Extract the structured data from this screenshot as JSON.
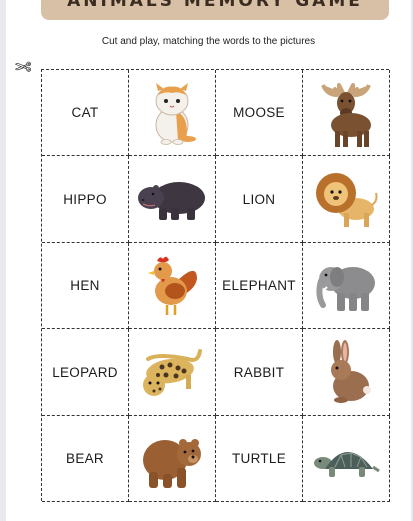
{
  "title": "ANIMALS MEMORY GAME",
  "subtitle": "Cut and play, matching the words to the pictures",
  "cut_icon": "scissors-icon",
  "cards": [
    {
      "word": "CAT",
      "picture": "cat-illustration"
    },
    {
      "word": "MOOSE",
      "picture": "moose-illustration"
    },
    {
      "word": "HIPPO",
      "picture": "hippo-illustration"
    },
    {
      "word": "LION",
      "picture": "lion-illustration"
    },
    {
      "word": "HEN",
      "picture": "hen-illustration"
    },
    {
      "word": "ELEPHANT",
      "picture": "elephant-illustration"
    },
    {
      "word": "LEOPARD",
      "picture": "leopard-illustration"
    },
    {
      "word": "RABBIT",
      "picture": "rabbit-illustration"
    },
    {
      "word": "BEAR",
      "picture": "bear-illustration"
    },
    {
      "word": "TURTLE",
      "picture": "turtle-illustration"
    }
  ],
  "colors": {
    "banner": "#d8c0a6",
    "banner_text": "#3b2c22",
    "card_border": "#333333"
  }
}
